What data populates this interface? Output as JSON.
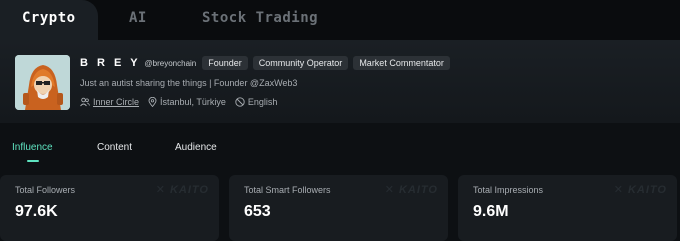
{
  "tabs": [
    {
      "label": "Crypto",
      "active": true
    },
    {
      "label": "AI",
      "active": false
    },
    {
      "label": "Stock Trading",
      "active": false
    }
  ],
  "profile": {
    "name": "B R E Y",
    "handle": "@breyonchain",
    "badges": [
      "Founder",
      "Community Operator",
      "Market Commentator"
    ],
    "bio": "Just an autist sharing the things | Founder @ZaxWeb3",
    "group": "Inner Circle",
    "location": "İstanbul, Türkiye",
    "language": "English",
    "avatar_bg": "#bfd8d8"
  },
  "sub_tabs": [
    {
      "label": "Influence",
      "active": true
    },
    {
      "label": "Content",
      "active": false
    },
    {
      "label": "Audience",
      "active": false
    }
  ],
  "stats": [
    {
      "label": "Total Followers",
      "value": "97.6K"
    },
    {
      "label": "Total Smart Followers",
      "value": "653"
    },
    {
      "label": "Total Impressions",
      "value": "9.6M"
    }
  ],
  "watermark": "KAITO",
  "colors": {
    "accent": "#5ee3c0",
    "background": "#0d1013",
    "panel": "#1a1f24",
    "card": "#181c20"
  }
}
